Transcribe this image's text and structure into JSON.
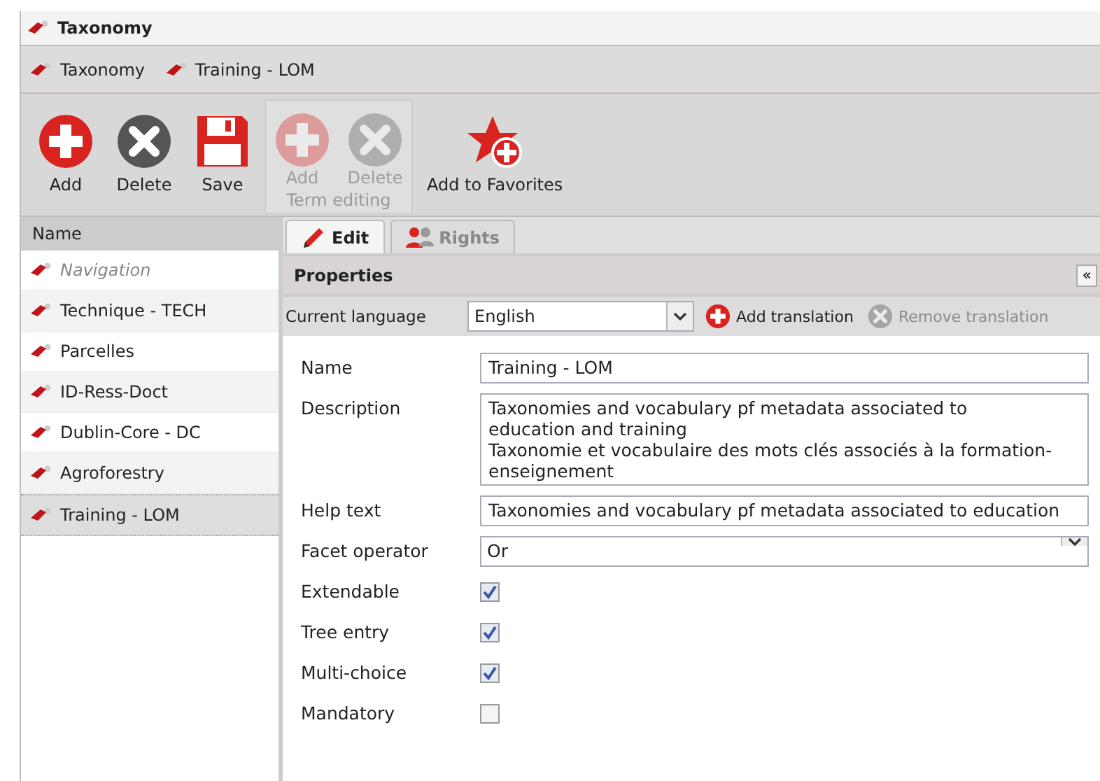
{
  "window": {
    "title": "Taxonomy"
  },
  "breadcrumbs": [
    {
      "label": "Taxonomy"
    },
    {
      "label": "Training - LOM"
    }
  ],
  "toolbar": [
    {
      "kind": "add",
      "label": "Add",
      "disabled": false
    },
    {
      "kind": "delete",
      "label": "Delete",
      "disabled": false
    },
    {
      "kind": "save",
      "label": "Save",
      "disabled": false
    },
    {
      "kind": "group",
      "label": "Term editing",
      "buttons": [
        {
          "kind": "add",
          "label": "Add",
          "disabled": true
        },
        {
          "kind": "delete",
          "label": "Delete",
          "disabled": true
        }
      ]
    },
    {
      "kind": "favorite",
      "label": "Add to Favorites",
      "disabled": false
    }
  ],
  "sidebar": {
    "header": "Name",
    "items": [
      {
        "label": "Navigation",
        "dimmed": true,
        "selected": false
      },
      {
        "label": "Technique - TECH",
        "dimmed": false,
        "selected": false
      },
      {
        "label": "Parcelles",
        "dimmed": false,
        "selected": false
      },
      {
        "label": "ID-Ress-Doct",
        "dimmed": false,
        "selected": false
      },
      {
        "label": "Dublin-Core - DC",
        "dimmed": false,
        "selected": false
      },
      {
        "label": "Agroforestry",
        "dimmed": false,
        "selected": false
      },
      {
        "label": "Training - LOM",
        "dimmed": false,
        "selected": true
      }
    ]
  },
  "tabs": [
    {
      "label": "Edit",
      "selected": true
    },
    {
      "label": "Rights",
      "selected": false
    }
  ],
  "properties": {
    "title": "Properties",
    "collapse": "«",
    "language": {
      "label": "Current language",
      "value": "English",
      "add": {
        "label": "Add translation",
        "disabled": false
      },
      "remove": {
        "label": "Remove translation",
        "disabled": true
      }
    },
    "fields": [
      {
        "kind": "text",
        "label": "Name",
        "value": "Training - LOM"
      },
      {
        "kind": "textarea",
        "label": "Description",
        "lines": [
          "Taxonomies and vocabulary pf metadata associated to",
          "education and training",
          "Taxonomie et vocabulaire des mots clés associés à la formation-",
          "enseignement"
        ]
      },
      {
        "kind": "text",
        "label": "Help text",
        "value": "Taxonomies and vocabulary pf metadata associated to education"
      },
      {
        "kind": "select",
        "label": "Facet operator",
        "value": "Or"
      },
      {
        "kind": "checkbox",
        "label": "Extendable",
        "checked": true
      },
      {
        "kind": "checkbox",
        "label": "Tree entry",
        "checked": true
      },
      {
        "kind": "checkbox",
        "label": "Multi-choice",
        "checked": true
      },
      {
        "kind": "checkbox",
        "label": "Mandatory",
        "checked": false
      }
    ]
  }
}
